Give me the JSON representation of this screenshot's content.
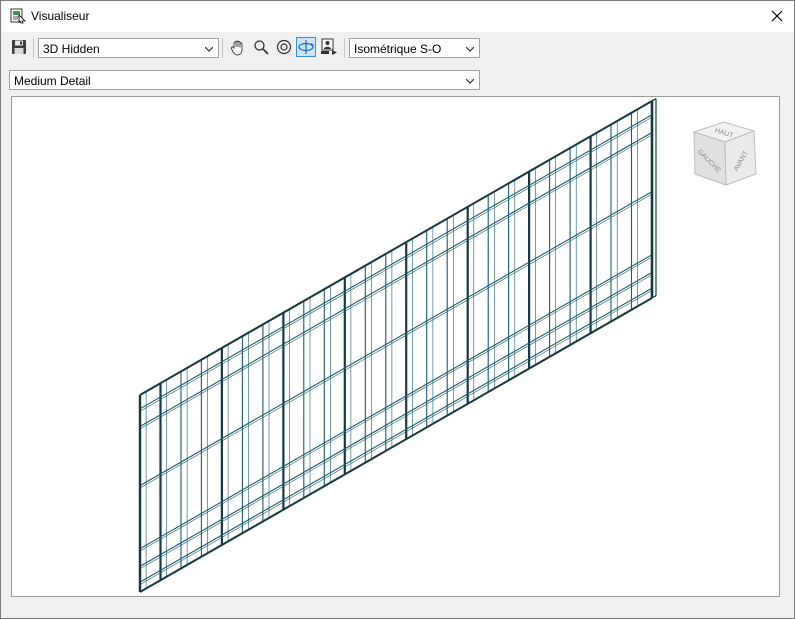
{
  "window": {
    "title": "Visualiseur"
  },
  "toolbar": {
    "visual_style": "3D Hidden",
    "view": "Isométrique S-O"
  },
  "detail": {
    "level": "Medium Detail"
  },
  "viewcube": {
    "top": "HAUT",
    "left": "GAUCHE",
    "front": "AVANT"
  },
  "colors": {
    "model_stroke": "#1e5a6e",
    "model_edge": "#173844",
    "active_tool": "#cce4f7"
  },
  "icons": [
    "viewer-app-icon",
    "close-icon",
    "save-icon",
    "pan-hand-icon",
    "zoom-icon",
    "orbit-target-icon",
    "orbit-icon",
    "camera-icon",
    "chevron-down-icon"
  ]
}
